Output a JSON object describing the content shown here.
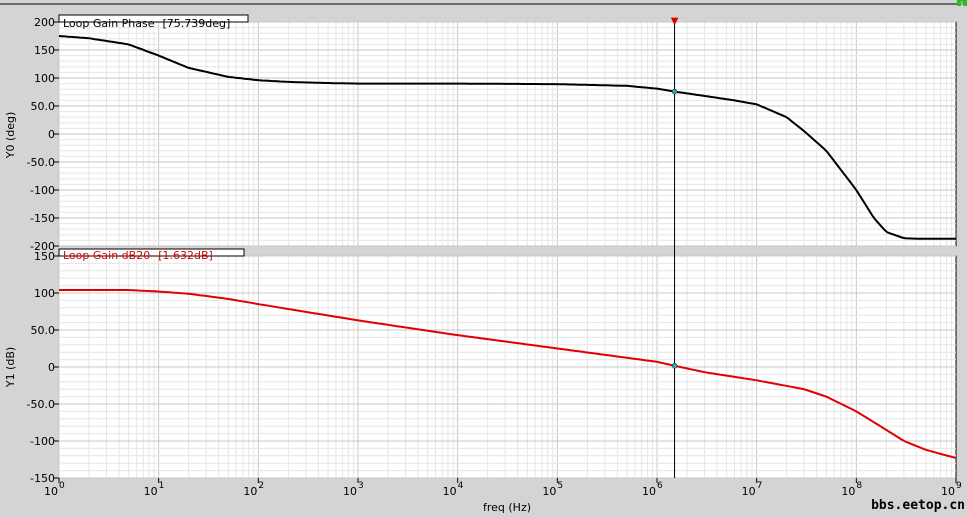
{
  "window": {
    "corner_badge": "1"
  },
  "watermark": "bbs.eetop.cn",
  "chart_data": [
    {
      "type": "line",
      "trace_label": "Loop Gain Phase",
      "cursor_readout": "[75.739deg]",
      "ylabel": "Y0 (deg)",
      "ylim": [
        -200,
        200
      ],
      "yticks": [
        200,
        150,
        100,
        50,
        0,
        -50,
        -100,
        -150,
        -200
      ],
      "ytick_labels": [
        "200",
        "150",
        "100",
        "50.0",
        "0",
        "-50.0",
        "-100",
        "-150",
        "-200"
      ],
      "xscale": "log",
      "xlim": [
        1,
        1000000000
      ],
      "color": "#000000",
      "grid": true,
      "series": [
        {
          "x": [
            1,
            2,
            5,
            10,
            20,
            50,
            100,
            200,
            500,
            1000,
            10000,
            100000,
            500000,
            1000000,
            1500000,
            3000000,
            6000000,
            10000000,
            20000000,
            30000000,
            50000000,
            100000000,
            150000000,
            200000000,
            300000000,
            400000000,
            1000000000
          ],
          "y": [
            175,
            171,
            160,
            140,
            118,
            102,
            96,
            93,
            91,
            90,
            90,
            89,
            86,
            81,
            75.739,
            68,
            60,
            53,
            30,
            5,
            -30,
            -100,
            -150,
            -175,
            -186,
            -187,
            -187
          ]
        }
      ]
    },
    {
      "type": "line",
      "trace_label": "Loop Gain dB20",
      "cursor_readout": "[1.632dB]",
      "ylabel": "Y1 (dB)",
      "xlabel": "freq (Hz)",
      "ylim": [
        -150,
        150
      ],
      "yticks": [
        150,
        100,
        50,
        0,
        -50,
        -100,
        -150
      ],
      "ytick_labels": [
        "150",
        "100",
        "50.0",
        "0",
        "-50.0",
        "-100",
        "-150"
      ],
      "xscale": "log",
      "xlim": [
        1,
        1000000000
      ],
      "xticks": [
        1,
        10,
        100,
        1000,
        10000,
        100000,
        1000000,
        10000000,
        100000000,
        1000000000
      ],
      "xtick_bases": [
        "10",
        "10",
        "10",
        "10",
        "10",
        "10",
        "10",
        "10",
        "10",
        "10"
      ],
      "xtick_exponents": [
        "0",
        "1",
        "2",
        "3",
        "4",
        "5",
        "6",
        "7",
        "8",
        "9"
      ],
      "color": "#e00000",
      "grid": true,
      "series": [
        {
          "x": [
            1,
            5,
            10,
            20,
            50,
            100,
            1000,
            10000,
            100000,
            1000000,
            1500000,
            3000000,
            10000000,
            30000000,
            50000000,
            100000000,
            200000000,
            300000000,
            500000000,
            1000000000
          ],
          "y": [
            104,
            104,
            102,
            99,
            92,
            85,
            63,
            43,
            25,
            7,
            1.632,
            -7,
            -18,
            -30,
            -40,
            -60,
            -85,
            -100,
            -112,
            -123
          ]
        }
      ]
    }
  ],
  "cursor": {
    "x": 1500000,
    "marker": "▼"
  }
}
